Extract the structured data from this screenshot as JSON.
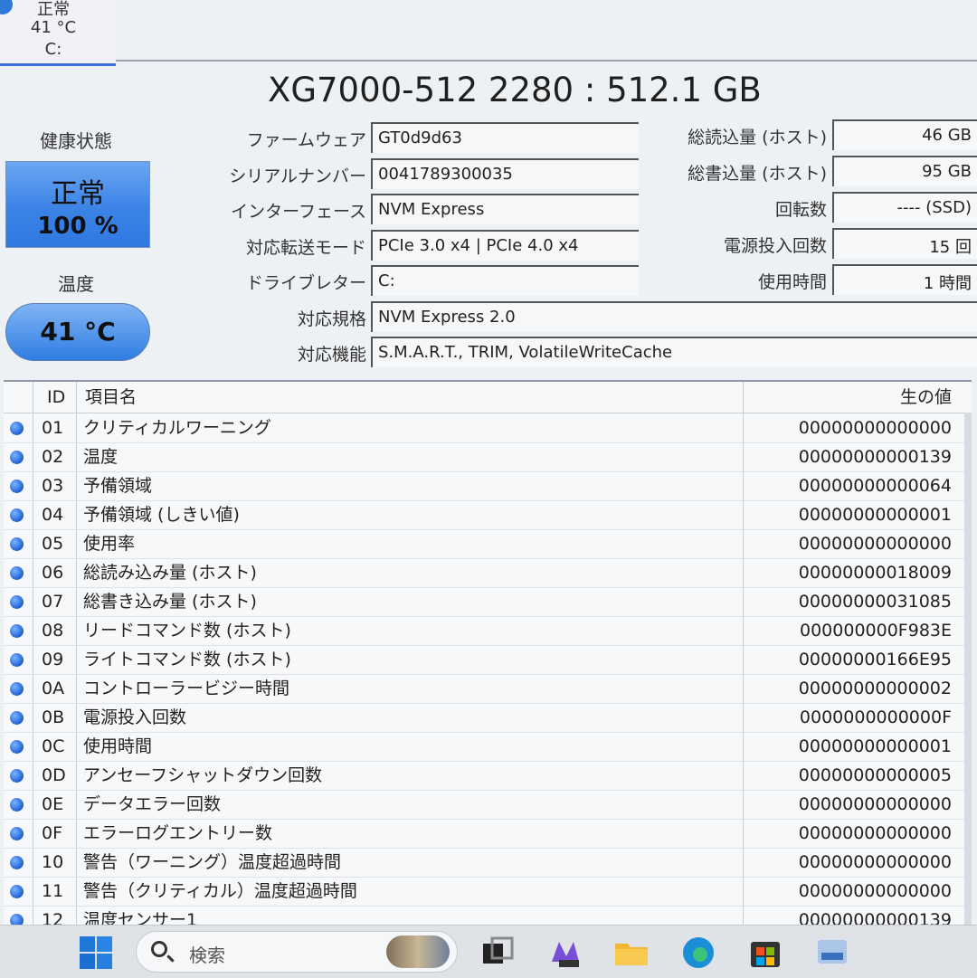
{
  "drive_tab": {
    "status": "正常",
    "temperature": "41 °C",
    "letter": "C:"
  },
  "model_title": "XG7000-512 2280 : 512.1 GB",
  "health": {
    "label": "健康状態",
    "status": "正常",
    "percent": "100 %"
  },
  "temperature": {
    "label": "温度",
    "value": "41 °C"
  },
  "info_left": [
    {
      "label": "ファームウェア",
      "value": "GT0d9d63"
    },
    {
      "label": "シリアルナンバー",
      "value": "0041789300035"
    },
    {
      "label": "インターフェース",
      "value": "NVM Express"
    },
    {
      "label": "対応転送モード",
      "value": "PCIe 3.0 x4 | PCIe 4.0 x4"
    },
    {
      "label": "ドライブレター",
      "value": "C:"
    },
    {
      "label": "対応規格",
      "value": "NVM Express 2.0"
    },
    {
      "label": "対応機能",
      "value": "S.M.A.R.T., TRIM, VolatileWriteCache"
    }
  ],
  "info_right": [
    {
      "label": "総読込量 (ホスト)",
      "value": "46 GB"
    },
    {
      "label": "総書込量 (ホスト)",
      "value": "95 GB"
    },
    {
      "label": "回転数",
      "value": "---- (SSD)"
    },
    {
      "label": "電源投入回数",
      "value": "15 回"
    },
    {
      "label": "使用時間",
      "value": "1 時間"
    }
  ],
  "smart": {
    "headers": {
      "id": "ID",
      "name": "項目名",
      "raw": "生の値"
    },
    "rows": [
      {
        "id": "01",
        "name": "クリティカルワーニング",
        "raw": "00000000000000"
      },
      {
        "id": "02",
        "name": "温度",
        "raw": "00000000000139"
      },
      {
        "id": "03",
        "name": "予備領域",
        "raw": "00000000000064"
      },
      {
        "id": "04",
        "name": "予備領域 (しきい値)",
        "raw": "00000000000001"
      },
      {
        "id": "05",
        "name": "使用率",
        "raw": "00000000000000"
      },
      {
        "id": "06",
        "name": "総読み込み量 (ホスト)",
        "raw": "00000000018009"
      },
      {
        "id": "07",
        "name": "総書き込み量 (ホスト)",
        "raw": "00000000031085"
      },
      {
        "id": "08",
        "name": "リードコマンド数 (ホスト)",
        "raw": "000000000F983E"
      },
      {
        "id": "09",
        "name": "ライトコマンド数 (ホスト)",
        "raw": "00000000166E95"
      },
      {
        "id": "0A",
        "name": "コントローラービジー時間",
        "raw": "00000000000002"
      },
      {
        "id": "0B",
        "name": "電源投入回数",
        "raw": "0000000000000F"
      },
      {
        "id": "0C",
        "name": "使用時間",
        "raw": "00000000000001"
      },
      {
        "id": "0D",
        "name": "アンセーフシャットダウン回数",
        "raw": "00000000000005"
      },
      {
        "id": "0E",
        "name": "データエラー回数",
        "raw": "00000000000000"
      },
      {
        "id": "0F",
        "name": "エラーログエントリー数",
        "raw": "00000000000000"
      },
      {
        "id": "10",
        "name": "警告（ワーニング）温度超過時間",
        "raw": "00000000000000"
      },
      {
        "id": "11",
        "name": "警告（クリティカル）温度超過時間",
        "raw": "00000000000000"
      },
      {
        "id": "12",
        "name": "温度センサー1",
        "raw": "00000000000139"
      }
    ]
  },
  "taskbar": {
    "search_placeholder": "検索"
  },
  "colors": {
    "accent": "#2f7ad9",
    "health_blue": "#3b83e6",
    "window_bg": "#eef1f4"
  }
}
